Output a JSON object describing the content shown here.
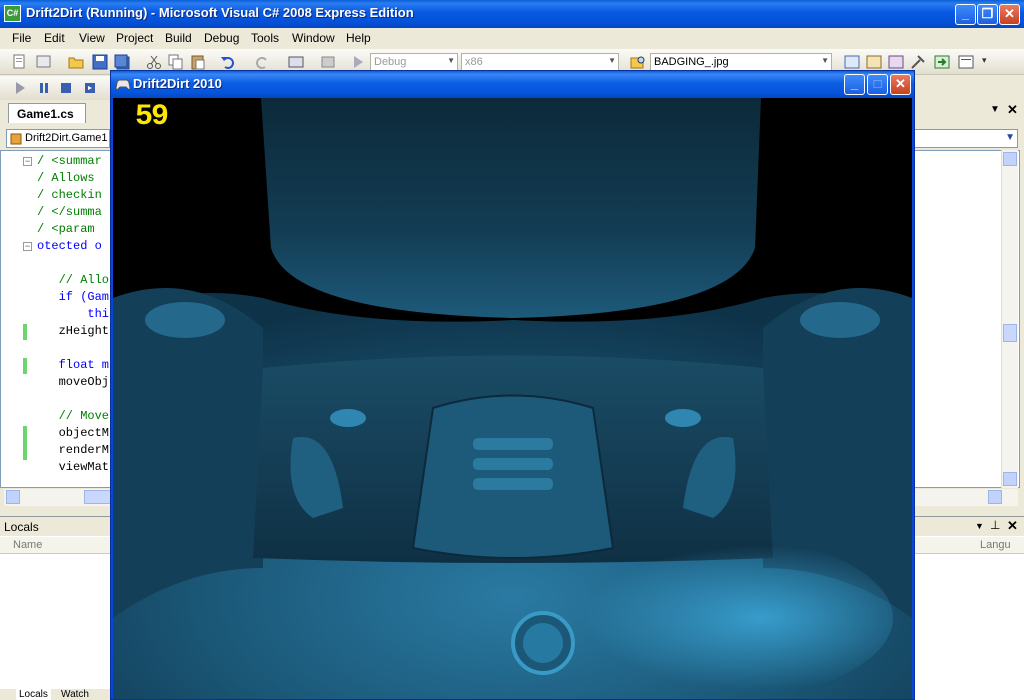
{
  "ide": {
    "title": "Drift2Dirt (Running) - Microsoft Visual C# 2008 Express Edition",
    "icon_label": "C#"
  },
  "menu": [
    "File",
    "Edit",
    "View",
    "Project",
    "Build",
    "Debug",
    "Tools",
    "Window",
    "Help"
  ],
  "toolbar": {
    "config_combo": "Debug",
    "platform_combo": "x86",
    "find_combo": "BADGING_.jpg"
  },
  "editor": {
    "tab": "Game1.cs",
    "class_combo": "Drift2Dirt.Game1",
    "lines": [
      {
        "text": "/ <summar",
        "style": "c-comment"
      },
      {
        "text": "/ Allows ",
        "style": "c-comment"
      },
      {
        "text": "/ checkin",
        "style": "c-comment"
      },
      {
        "text": "/ </summa",
        "style": "c-comment"
      },
      {
        "text": "/ <param ",
        "style": "c-comment"
      },
      {
        "text": "otected o",
        "style": "c-kw"
      },
      {
        "text": "",
        "style": "c-plain"
      },
      {
        "text": "   // Allo",
        "style": "c-comment"
      },
      {
        "text": "   if (Gam",
        "style": "c-kw"
      },
      {
        "text": "       thi",
        "style": "c-kw"
      },
      {
        "text": "   zHeight",
        "style": "c-plain"
      },
      {
        "text": "",
        "style": "c-plain"
      },
      {
        "text": "   float m",
        "style": "c-kw"
      },
      {
        "text": "   moveObj",
        "style": "c-plain"
      },
      {
        "text": "",
        "style": "c-plain"
      },
      {
        "text": "   // Move",
        "style": "c-comment"
      },
      {
        "text": "   objectM",
        "style": "c-plain"
      },
      {
        "text": "   renderM",
        "style": "c-plain"
      },
      {
        "text": "   viewMat",
        "style": "c-plain"
      }
    ]
  },
  "locals": {
    "title": "Locals",
    "col_name": "Name",
    "col_type": "Langu",
    "tab_locals": "Locals",
    "tab_watch": "Watch"
  },
  "game": {
    "title": "Drift2Dirt 2010",
    "fps": "59"
  },
  "colors": {
    "xp_blue": "#0a5fd8",
    "fps_yellow": "#ffe600",
    "car_teal": "#1d5a7a"
  }
}
